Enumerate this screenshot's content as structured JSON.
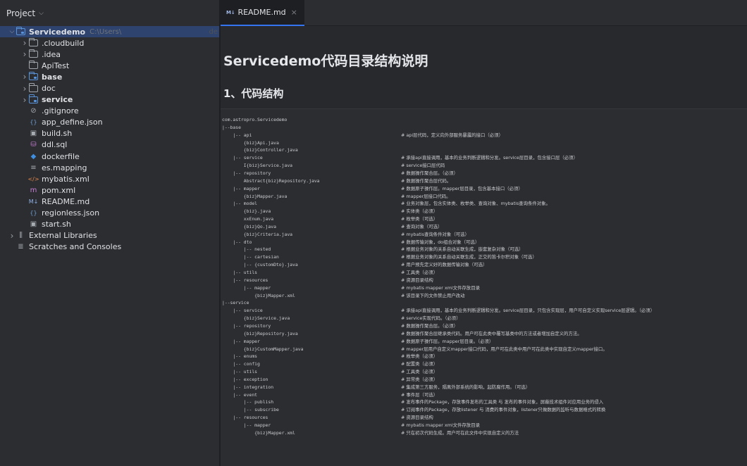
{
  "panel": {
    "title": "Project"
  },
  "tree": [
    {
      "depth": 0,
      "arrow": "expanded",
      "icon": "module-folder",
      "label": "Servicedemo",
      "bold": true,
      "hint": "C:\\Users\\",
      "hint_right": "de",
      "selected": true
    },
    {
      "depth": 1,
      "arrow": "collapsed",
      "icon": "folder",
      "label": ".cloudbuild"
    },
    {
      "depth": 1,
      "arrow": "collapsed",
      "icon": "folder",
      "label": ".idea"
    },
    {
      "depth": 1,
      "arrow": "none",
      "icon": "folder",
      "label": "ApiTest"
    },
    {
      "depth": 1,
      "arrow": "collapsed",
      "icon": "module-folder",
      "label": "base",
      "bold": true
    },
    {
      "depth": 1,
      "arrow": "collapsed",
      "icon": "folder",
      "label": "doc"
    },
    {
      "depth": 1,
      "arrow": "collapsed",
      "icon": "module-folder",
      "label": "service",
      "bold": true
    },
    {
      "depth": 1,
      "arrow": "none",
      "icon": "ignore",
      "label": ".gitignore"
    },
    {
      "depth": 1,
      "arrow": "none",
      "icon": "json",
      "label": "app_define.json"
    },
    {
      "depth": 1,
      "arrow": "none",
      "icon": "shell",
      "label": "build.sh"
    },
    {
      "depth": 1,
      "arrow": "none",
      "icon": "database",
      "label": "ddl.sql"
    },
    {
      "depth": 1,
      "arrow": "none",
      "icon": "docker",
      "label": "dockerfile"
    },
    {
      "depth": 1,
      "arrow": "none",
      "icon": "text",
      "label": "es.mapping"
    },
    {
      "depth": 1,
      "arrow": "none",
      "icon": "xml",
      "label": "mybatis.xml"
    },
    {
      "depth": 1,
      "arrow": "none",
      "icon": "maven",
      "label": "pom.xml"
    },
    {
      "depth": 1,
      "arrow": "none",
      "icon": "markdown",
      "label": "README.md"
    },
    {
      "depth": 1,
      "arrow": "none",
      "icon": "json",
      "label": "regionless.json"
    },
    {
      "depth": 1,
      "arrow": "none",
      "icon": "shell",
      "label": "start.sh"
    },
    {
      "depth": 0,
      "arrow": "collapsed",
      "icon": "libraries",
      "label": "External Libraries"
    },
    {
      "depth": 0,
      "arrow": "none",
      "icon": "scratches",
      "label": "Scratches and Consoles"
    }
  ],
  "tab": {
    "badge": "M↓",
    "label": "README.md"
  },
  "doc": {
    "title": "Servicedemo代码目录结构说明",
    "h2": "1、代码结构",
    "code_lines": [
      {
        "c": "com.astropro.Servicedemo",
        "m": ""
      },
      {
        "c": "|--base",
        "m": ""
      },
      {
        "c": "    |-- api",
        "m": "# api层代码，定义向外部服务暴露的接口（必须）"
      },
      {
        "c": "        {biz}Api.java",
        "m": ""
      },
      {
        "c": "        {biz}Controller.java",
        "m": ""
      },
      {
        "c": "    |-- service",
        "m": "# 承接api直接调用，基本的业务判断逻辑和分发。service层目录，包含接口层（必须）"
      },
      {
        "c": "        I{biz}Service.java",
        "m": "# service接口层代码"
      },
      {
        "c": "    |-- repository",
        "m": "# 数据操作聚合层。（必须）"
      },
      {
        "c": "        Abstract{biz}Repository.java",
        "m": "# 数据操作聚合层代码。"
      },
      {
        "c": "    |-- mapper",
        "m": "# 数据原子操作层。mapper层目录，包含基本接口（必须）"
      },
      {
        "c": "        {biz}Mapper.java",
        "m": "# mapper层接口代码。"
      },
      {
        "c": "    |-- model",
        "m": "# 业务对象层，包含实体类、枚举类、查询对象、mybatis查询条件对象。"
      },
      {
        "c": "        {biz}.java",
        "m": "# 实体类（必须）"
      },
      {
        "c": "        xxEnum.java",
        "m": "# 枚举类（可选）"
      },
      {
        "c": "        {biz}Qo.java",
        "m": "# 查询对象（可选）"
      },
      {
        "c": "        {biz}Criteria.java",
        "m": "# mybatis查询条件对象（可选）"
      },
      {
        "c": "    |-- dto",
        "m": "# 数据传输对象，do组合对象（可选）"
      },
      {
        "c": "        |-- nested",
        "m": "# 根据业务对象的关系自动关联生成，嵌套复杂对象（可选）"
      },
      {
        "c": "        |-- cartesian",
        "m": "# 根据业务对象的关系自动关联生成，正交的笛卡尔积对象（可选）"
      },
      {
        "c": "        |-- {customDto}.java",
        "m": "# 用户预先定义好的数据传输对象（可选）"
      },
      {
        "c": "    |-- utils",
        "m": "# 工具类（必须）"
      },
      {
        "c": "    |-- resources",
        "m": "# 资源目录结构"
      },
      {
        "c": "        |-- mapper",
        "m": "# mybatis mapper xml文件存放目录"
      },
      {
        "c": "            {biz}Mapper.xml",
        "m": "# 该目录下的文件禁止用户改动"
      },
      {
        "c": "|--service",
        "m": ""
      },
      {
        "c": "    |-- service",
        "m": "# 承接api直接调用，基本的业务判断逻辑和分发。service层目录，只包含实现层，用户可自定义实现service层逻辑。（必须）"
      },
      {
        "c": "        {biz}Service.java",
        "m": "# service实现代码。（必须）"
      },
      {
        "c": "    |-- repository",
        "m": "# 数据操作聚合层。（必须）"
      },
      {
        "c": "        {biz}Repository.java",
        "m": "# 数据操作聚合层继承类代码。用户可在此类中覆写基类中的方法或者增加自定义的方法。"
      },
      {
        "c": "    |-- mapper",
        "m": "# 数据原子操作层。mapper层目录。（必须）"
      },
      {
        "c": "        {biz}CustomMapper.java",
        "m": "# mapper层用户自定义mapper接口代码，用户可在此类中用户可在此类中实现自定义mapper接口。"
      },
      {
        "c": "    |-- enums",
        "m": "# 枚举类（必须）"
      },
      {
        "c": "    |-- config",
        "m": "# 配置类（必须）"
      },
      {
        "c": "    |-- utils",
        "m": "# 工具类（必须）"
      },
      {
        "c": "    |-- exception",
        "m": "# 异常类（必须）"
      },
      {
        "c": "    |-- integration",
        "m": "# 集成第三方服务，隔离外部系统的影响，起防腐作用。（可选）"
      },
      {
        "c": "    |-- event",
        "m": "# 事件层（可选）"
      },
      {
        "c": "        |-- publish",
        "m": "# 发布事件的Package，存放事件发布的工具类 与 发布的事件对象，屏蔽技术组件对应用业务的侵入"
      },
      {
        "c": "        |-- subscribe",
        "m": "# 订阅事件的Package，存放listener 与 消费的事件对象，listener只做数据的监听与数据格式的转换"
      },
      {
        "c": "    |-- resources",
        "m": "# 资源目录结构"
      },
      {
        "c": "        |-- mapper",
        "m": "# mybatis mapper xml文件存放目录"
      },
      {
        "c": "            {biz}Mapper.xml",
        "m": "# 只在初次代码生成。用户可在此文件中实现自定义的方法"
      }
    ]
  }
}
